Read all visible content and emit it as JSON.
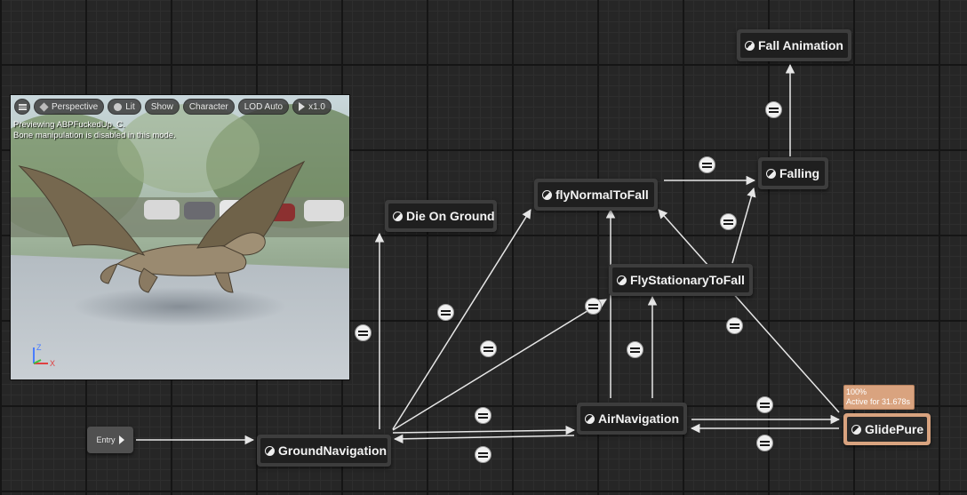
{
  "graph": {
    "entry_label": "Entry",
    "states": {
      "fall_animation": "Fall Animation",
      "falling": "Falling",
      "fly_normal_to_fall": "flyNormalToFall",
      "die_on_ground": "Die On Ground",
      "fly_stationary_to_fall": "FlyStationaryToFall",
      "air_navigation": "AirNavigation",
      "ground_navigation": "GroundNavigation",
      "glide_pure": "GlidePure"
    },
    "active_state": "GlidePure",
    "debug": {
      "weight": "100%",
      "active_time": "Active for 31.678s"
    },
    "colors": {
      "background": "#262626",
      "wire": "#e6e6e6",
      "active_state": "#d9a37f"
    }
  },
  "viewport": {
    "toolbar": {
      "menu_icon": "hamburger-icon",
      "perspective": "Perspective",
      "lit": "Lit",
      "show": "Show",
      "character": "Character",
      "lod": "LOD Auto",
      "speed": "x1.0"
    },
    "info_line1": "Previewing ABPFuckedUp_C.",
    "info_line2": "Bone manipulation is disabled in this mode.",
    "axis_z": "Z",
    "axis_x": "X"
  }
}
